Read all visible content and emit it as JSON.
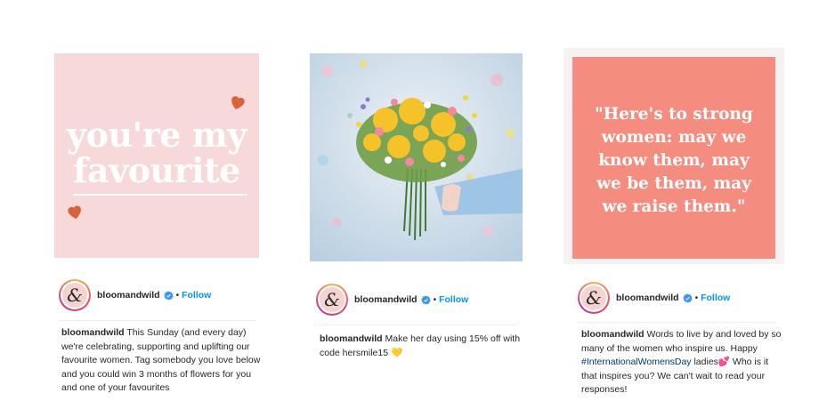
{
  "posts": [
    {
      "image": {
        "lines": [
          "you're my",
          "favourite"
        ],
        "heart_color": "#d9623b"
      },
      "username": "bloomandwild",
      "separator": "•",
      "follow_label": "Follow",
      "caption_user": "bloomandwild",
      "caption_text": "This Sunday (and every day) we're celebrating, supporting and uplifting our favourite women. Tag somebody you love below and you could win 3 months of flowers for you and one of your favourites"
    },
    {
      "image": {
        "description_icon": "flower-bouquet"
      },
      "username": "bloomandwild",
      "separator": "•",
      "follow_label": "Follow",
      "caption_user": "bloomandwild",
      "caption_text": "Make her day using 15% off with code hersmile15",
      "caption_emoji": "💛"
    },
    {
      "image": {
        "quote_lines": [
          "\"Here's to strong",
          "women: may we",
          "know them, may",
          "we be them, may",
          "we raise them.\""
        ]
      },
      "username": "bloomandwild",
      "separator": "•",
      "follow_label": "Follow",
      "caption_user": "bloomandwild",
      "caption_text_1": "Words to live by and loved by so many of the women who inspire us. Happy",
      "caption_hashtag": "#InternationalWomensDay",
      "caption_text_2": "ladies",
      "caption_emoji": "💕",
      "caption_text_3": "Who is it that inspires you? We can't wait to read your responses!"
    }
  ],
  "colors": {
    "follow": "#0095f6",
    "verified": "#3897f0",
    "quote_bg": "#f58c80",
    "pink_bg": "#f6d9d8"
  },
  "avatar_glyph": "&"
}
